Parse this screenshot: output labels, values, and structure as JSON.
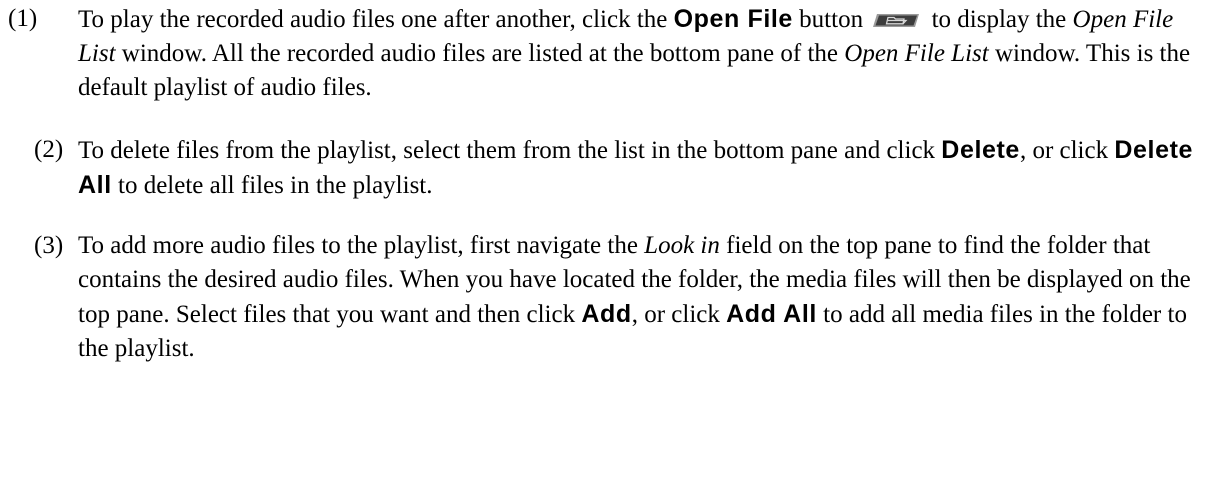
{
  "items": [
    {
      "number": "(1)",
      "s1": "To play the recorded audio files one after another, click the ",
      "open_file": "Open File",
      "s2": "button ",
      "s3": " to display the ",
      "window_1": "Open File List",
      "s4": " window. All the recorded audio files are listed at the bottom pane of the ",
      "window_2": "Open File List",
      "s5": " window. This is the default playlist of audio files.",
      "icon": "open-folder-icon"
    },
    {
      "number": "(2)",
      "s1": "To delete files from the playlist, select them from the list in the bottom pane and click ",
      "delete": "Delete",
      "s2": ", or click ",
      "delete_all": "Delete All",
      "s3": " to delete all files in the playlist."
    },
    {
      "number": "(3)",
      "s1": "To add more audio files to the playlist, first navigate the ",
      "look_in": "Look in",
      "s2": " field on the top pane to find the folder that contains the desired audio files. When you have located the folder, the media files will then be displayed on the top pane. Select files that you want and then click ",
      "add": "Add",
      "s3": ", or click ",
      "add_all": "Add All",
      "s4": " to add all media files in the folder to the playlist."
    }
  ],
  "colors": {
    "icon_fill_dark": "#3d3d3d",
    "icon_fill_light": "#9a9a9a"
  }
}
